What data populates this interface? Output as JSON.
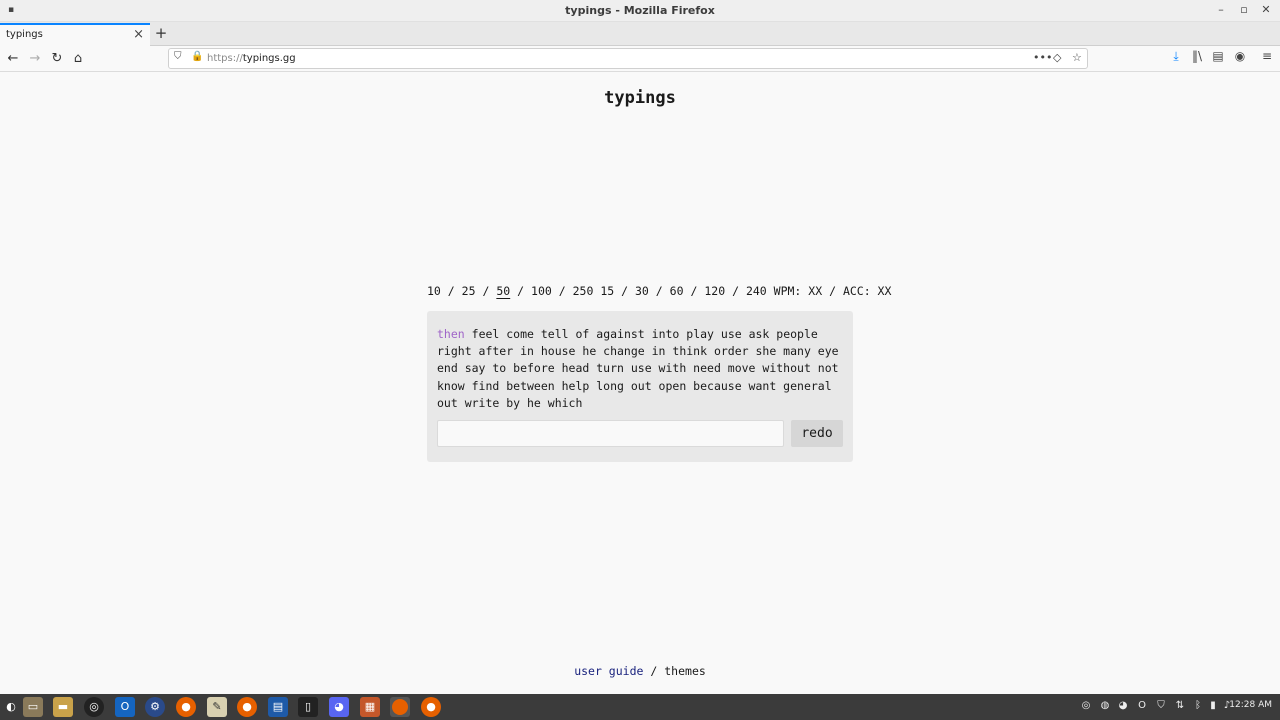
{
  "window": {
    "title": "typings - Mozilla Firefox"
  },
  "tabs": [
    {
      "label": "typings"
    }
  ],
  "urlbar": {
    "scheme": "https://",
    "host": "typings.gg"
  },
  "site": {
    "title": "typings",
    "word_counts": [
      "10",
      "25",
      "50",
      "100",
      "250"
    ],
    "selected_word_count": "50",
    "times": [
      "15",
      "30",
      "60",
      "120",
      "240"
    ],
    "separator": "/",
    "wpm_label": "WPM: XX",
    "acc_label": "ACC: XX",
    "current_word": "then",
    "remaining_words": "feel come tell of against into play use ask people right after in house he change in think order she many eye end say to before head turn use with need move without not know find between help long out open because want general out write by he which",
    "input_value": "",
    "redo_label": "redo",
    "footer": {
      "user_guide": "user guide",
      "separator": "/",
      "themes": "themes"
    }
  },
  "taskbar": {
    "clock": "12:28 AM"
  },
  "colors": {
    "current_word": "#a066c8",
    "link": "#1a237e",
    "accent": "#0a84ff"
  }
}
